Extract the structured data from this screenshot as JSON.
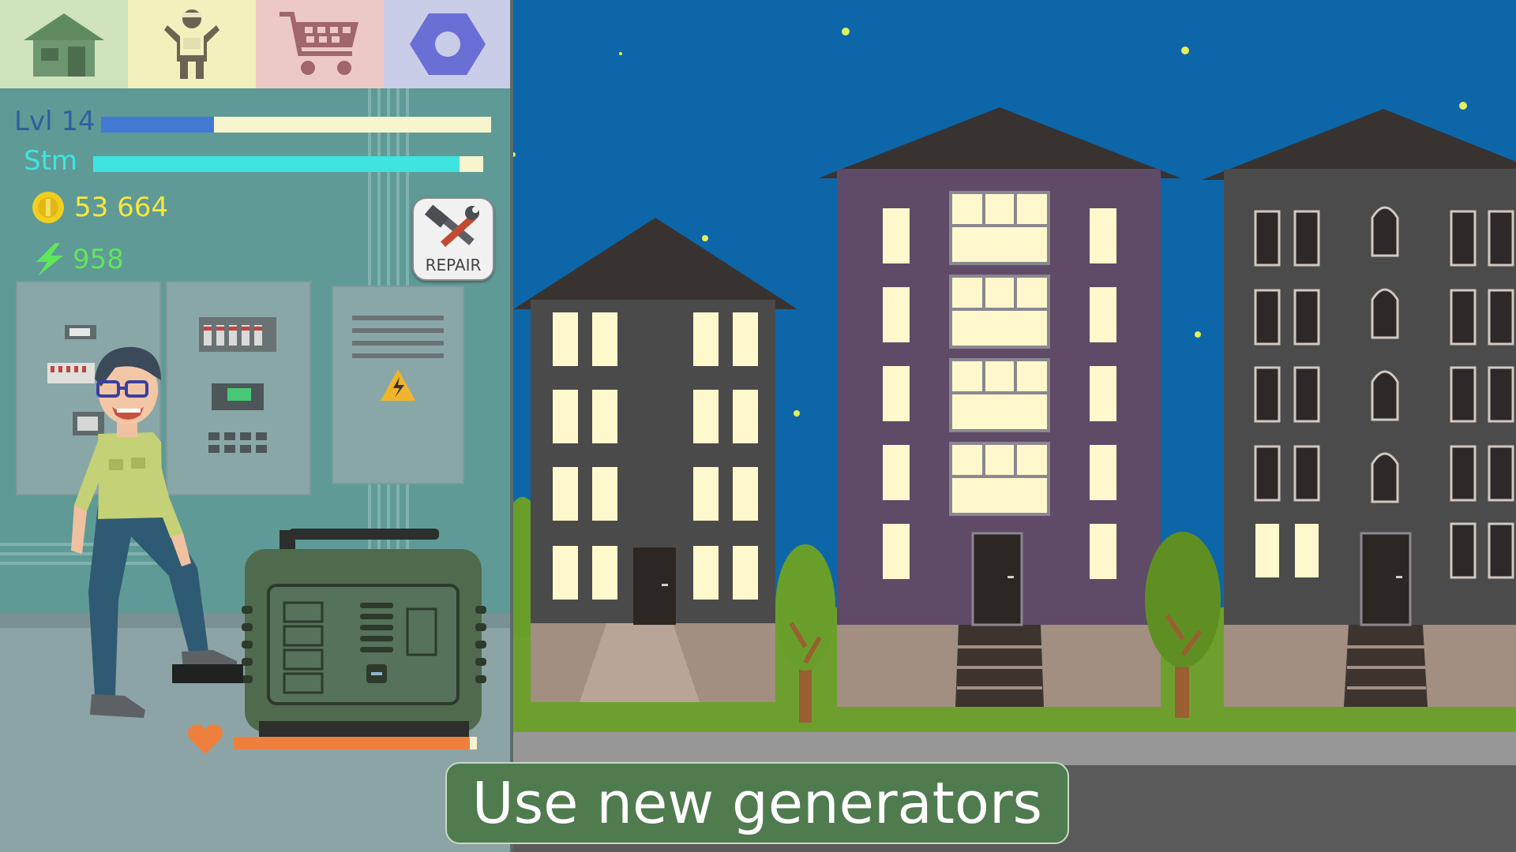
{
  "tabs": [
    {
      "name": "home-icon",
      "bg": "#cfe3bd"
    },
    {
      "name": "character-icon",
      "bg": "#f2f0bd"
    },
    {
      "name": "shop-cart-icon",
      "bg": "#ecc9c6"
    },
    {
      "name": "hex-nut-icon",
      "bg": "#c9cde8"
    }
  ],
  "stats": {
    "level_label": "Lvl 14",
    "level_progress": 0.29,
    "stamina_label": "Stm",
    "stamina_progress": 0.94
  },
  "resources": {
    "coins": "53 664",
    "energy": "958"
  },
  "repair_button": {
    "label": "REPAIR"
  },
  "generator": {
    "health": 0.97
  },
  "caption": "Use new generators",
  "colors": {
    "level_bar": "#4279d3",
    "stamina_bar": "#3fe4e0",
    "coin_text": "#f6e73d",
    "energy_text": "#5fe65a",
    "health_bar": "#ef7f3c",
    "sky": "#0d66a8"
  }
}
